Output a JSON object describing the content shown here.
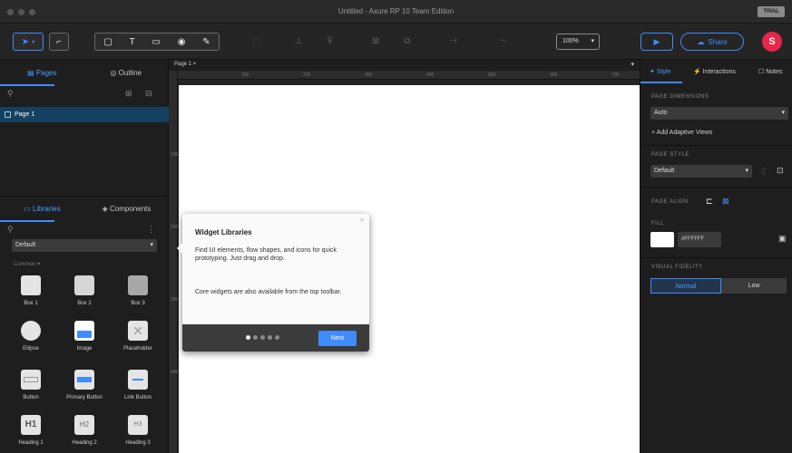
{
  "window": {
    "title": "Untitled - Axure RP 10 Team Edition",
    "badge": "TRIAL"
  },
  "toolbar": {
    "zoom": "100%",
    "share_label": "Share",
    "avatar_letter": "S",
    "text_tool": "T"
  },
  "left_panel": {
    "tabs": [
      "Pages",
      "Outline"
    ],
    "page_item": "Page 1",
    "lib_tabs": [
      "Libraries",
      "Components"
    ],
    "library_select": "Default",
    "section": "Common",
    "widgets": [
      "Box 1",
      "Box 2",
      "Box 3",
      "Ellipse",
      "Image",
      "Placeholder",
      "Button",
      "Primary Button",
      "Link Button",
      "Heading 1",
      "Heading 2",
      "Heading 3"
    ]
  },
  "canvas": {
    "page_tab": "Page 1",
    "ruler_h": [
      "100",
      "200",
      "300",
      "400",
      "500",
      "600",
      "700"
    ],
    "ruler_v": [
      "100",
      "200",
      "300",
      "400"
    ]
  },
  "tooltip": {
    "title": "Widget Libraries",
    "para1": "Find UI elements, flow shapes, and icons for quick prototyping. Just drag and drop.",
    "para2": "Core widgets are also available from the top toolbar.",
    "next_label": "Next",
    "steps": 5,
    "current_step": 1
  },
  "right_panel": {
    "tabs": [
      "Style",
      "Interactions",
      "Notes"
    ],
    "page_dimensions_label": "PAGE DIMENSIONS",
    "dimensions_value": "Auto",
    "adaptive_link": "+ Add Adaptive Views",
    "page_style_label": "PAGE STYLE",
    "style_value": "Default",
    "page_align_label": "PAGE ALIGN",
    "fill_label": "FILL",
    "fill_hex": "#FFFFFF",
    "visual_fidelity_label": "VISUAL FIDELITY",
    "fidelity_options": [
      "Normal",
      "Low"
    ]
  },
  "colors": {
    "accent": "#3f8cff",
    "avatar": "#e8264a",
    "selected_page": "#15405f"
  }
}
